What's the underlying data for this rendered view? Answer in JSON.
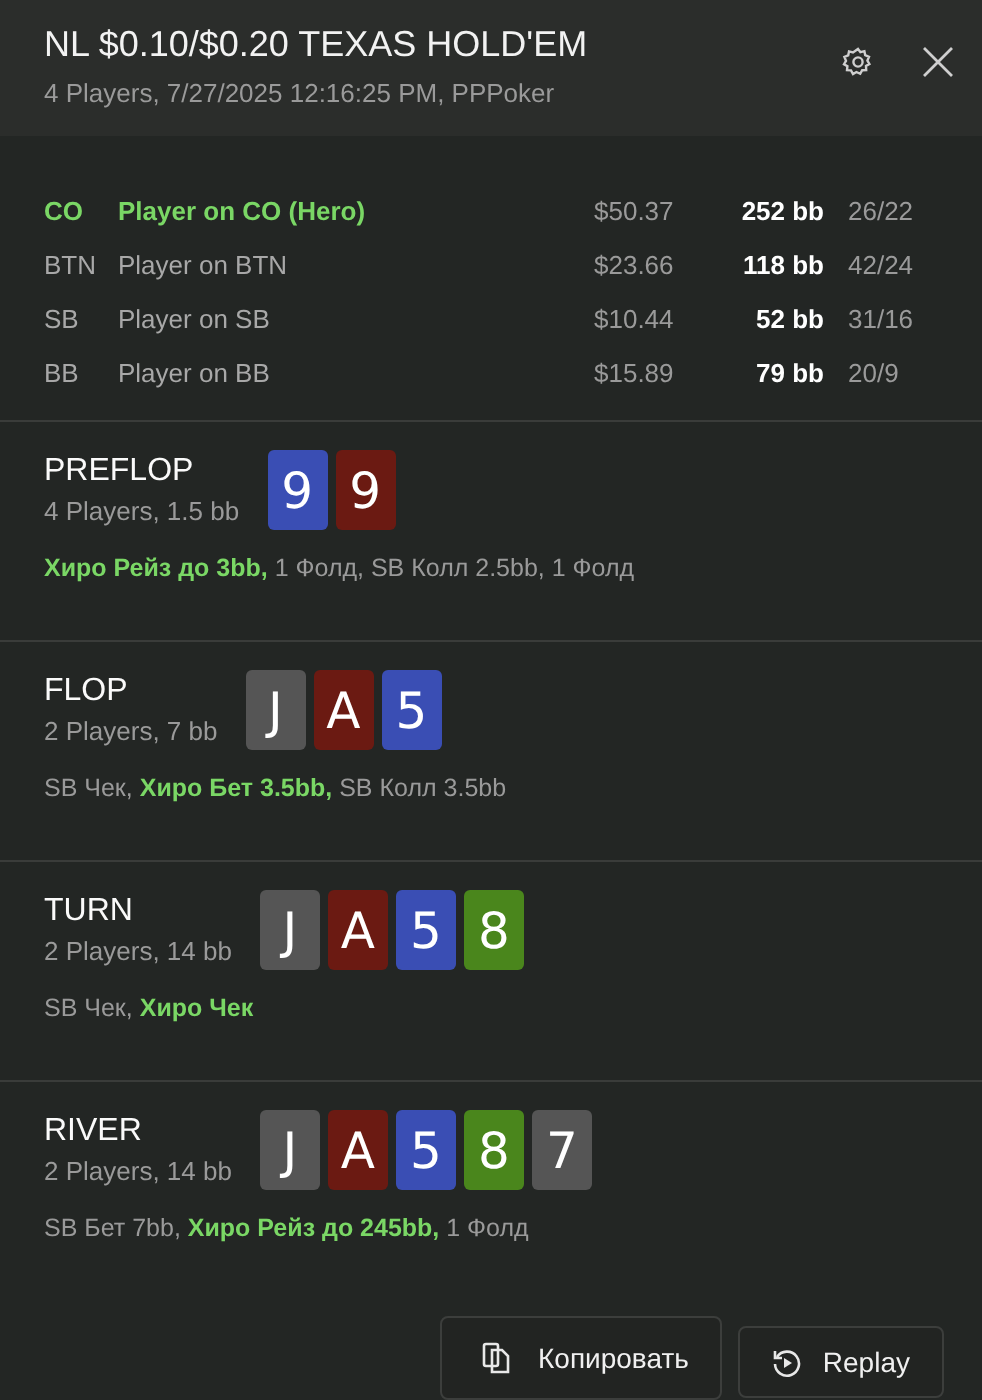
{
  "header": {
    "title": "NL $0.10/$0.20 TEXAS HOLD'EM",
    "subtitle": "4 Players, 7/27/2025 12:16:25 PM, PPPoker"
  },
  "players": [
    {
      "position": "CO",
      "name": "Player on CO (Hero)",
      "hero": true,
      "stack": "$50.37",
      "bb": "252 bb",
      "stats": "26/22"
    },
    {
      "position": "BTN",
      "name": "Player on BTN",
      "hero": false,
      "stack": "$23.66",
      "bb": "118 bb",
      "stats": "42/24"
    },
    {
      "position": "SB",
      "name": "Player on SB",
      "hero": false,
      "stack": "$10.44",
      "bb": "52 bb",
      "stats": "31/16"
    },
    {
      "position": "BB",
      "name": "Player on BB",
      "hero": false,
      "stack": "$15.89",
      "bb": "79 bb",
      "stats": "20/9"
    }
  ],
  "streets": [
    {
      "name": "PREFLOP",
      "info": "4 Players, 1.5 bb",
      "cards": [
        {
          "rank": "9",
          "color": "#3a4eb4"
        },
        {
          "rank": "9",
          "color": "#6b1a12"
        }
      ],
      "actions": "**Хиро Рейз до 3bb,** 1 Фолд, SB Колл 2.5bb, 1 Фолд"
    },
    {
      "name": "FLOP",
      "info": "2 Players, 7 bb",
      "cards": [
        {
          "rank": "J",
          "color": "#555555"
        },
        {
          "rank": "A",
          "color": "#6b1a12"
        },
        {
          "rank": "5",
          "color": "#3a4eb4"
        }
      ],
      "actions": "SB Чек, **Хиро Бет 3.5bb,** SB Колл 3.5bb"
    },
    {
      "name": "TURN",
      "info": "2 Players, 14 bb",
      "cards": [
        {
          "rank": "J",
          "color": "#555555"
        },
        {
          "rank": "A",
          "color": "#6b1a12"
        },
        {
          "rank": "5",
          "color": "#3a4eb4"
        },
        {
          "rank": "8",
          "color": "#4a861c"
        }
      ],
      "actions": "SB Чек, **Хиро Чек**"
    },
    {
      "name": "RIVER",
      "info": "2 Players, 14 bb",
      "cards": [
        {
          "rank": "J",
          "color": "#555555"
        },
        {
          "rank": "A",
          "color": "#6b1a12"
        },
        {
          "rank": "5",
          "color": "#3a4eb4"
        },
        {
          "rank": "8",
          "color": "#4a861c"
        },
        {
          "rank": "7",
          "color": "#555555"
        }
      ],
      "actions": "SB Бет 7bb, **Хиро Рейз до 245bb,** 1 Фолд"
    }
  ],
  "buttons": [
    {
      "label": "Копировать",
      "kind": "copy"
    },
    {
      "label": "Replay",
      "kind": "replay"
    }
  ]
}
